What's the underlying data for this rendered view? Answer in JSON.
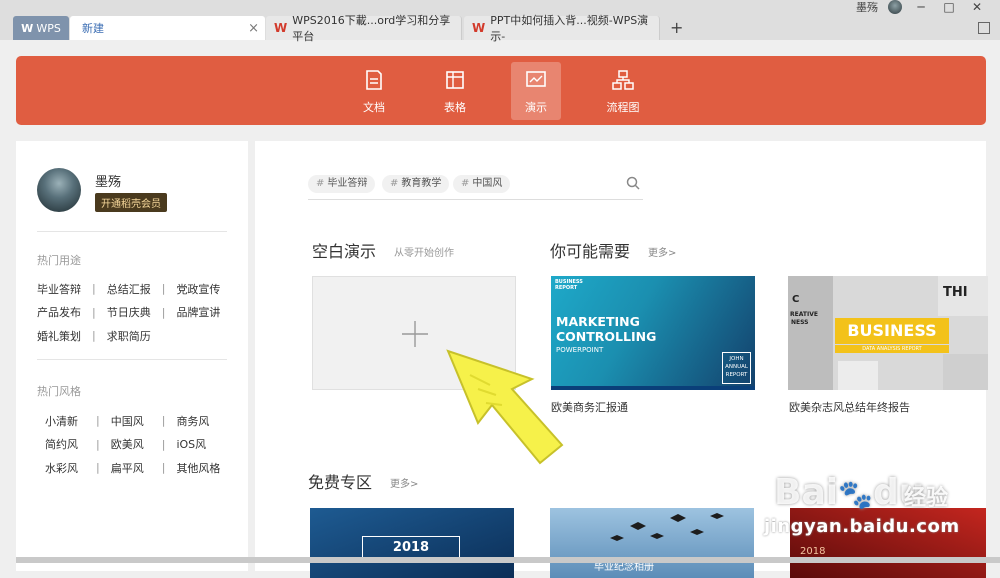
{
  "window": {
    "user_name": "墨殇",
    "buttons": [
      "─",
      "□",
      "✕"
    ]
  },
  "tabs": {
    "wps": "WPS",
    "new": "新建",
    "close": "×",
    "doc1": "WPS2016下載...ord学习和分享平台",
    "doc2": "PPT中如何插入背...视频-WPS演示-",
    "doc_icon": "W",
    "add": "+"
  },
  "header": {
    "tabs": [
      {
        "label": "文档",
        "icon": "document-icon"
      },
      {
        "label": "表格",
        "icon": "table-icon"
      },
      {
        "label": "演示",
        "icon": "presentation-icon",
        "active": true
      },
      {
        "label": "流程图",
        "icon": "flowchart-icon"
      }
    ],
    "color": "#e05d41"
  },
  "sidebar": {
    "user_name": "墨殇",
    "vip_button": "开通稻壳会员",
    "hot_use_title": "热门用途",
    "hot_use": [
      [
        "毕业答辩",
        "总结汇报",
        "党政宣传"
      ],
      [
        "产品发布",
        "节日庆典",
        "品牌宣讲"
      ],
      [
        "婚礼策划",
        "求职简历"
      ]
    ],
    "hot_style_title": "热门风格",
    "hot_style": [
      [
        "小清新",
        "中国风",
        "商务风"
      ],
      [
        "简约风",
        "欧美风",
        "iOS风"
      ],
      [
        "水彩风",
        "扁平风",
        "其他风格"
      ]
    ],
    "divider": "|"
  },
  "main": {
    "search_tags": [
      "毕业答辩",
      "教育教学",
      "中国风"
    ],
    "hash": "#",
    "blank_title": "空白演示",
    "blank_sub": "从零开始创作",
    "blank_plus": "+",
    "maybe_title": "你可能需要",
    "more": "更多>",
    "free_title": "免费专区",
    "templates": [
      {
        "caption": "欧美商务汇报通",
        "small_top": "BUSINESS\nREPORT",
        "line1": "MARKETING",
        "line2": "CONTROLLING",
        "line3": "POWERPOINT",
        "box": "JOHN\nANNUAL\nREPORT"
      },
      {
        "caption": "欧美杂志风总结年终报告",
        "title": "BUSINESS",
        "subtitle": "DATA ANALYSIS REPORT"
      }
    ],
    "free_templates": [
      {
        "year": "2018"
      },
      {
        "text": "毕业纪念相册"
      },
      {
        "year": "2018"
      }
    ]
  },
  "watermark": {
    "brand": "Bai",
    "brand2": "du",
    "cn": "经验",
    "url": "jingyan.baidu.com"
  }
}
